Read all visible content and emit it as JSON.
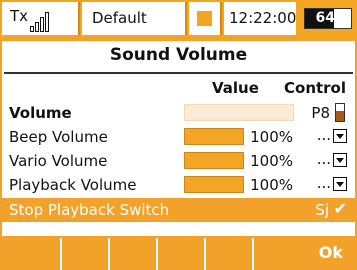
{
  "status": {
    "tx_label": "Tx",
    "profile": "Default",
    "time": "12:22:00",
    "battery_percent": 64,
    "battery_text": "64%"
  },
  "screen": {
    "title": "Sound Volume",
    "col_value": "Value",
    "col_control": "Control",
    "rows": [
      {
        "label": "Volume",
        "value_fraction": 1.0,
        "control": "P8"
      },
      {
        "label": "Beep Volume",
        "value_fraction": 1.0,
        "percent": "100%",
        "control": "..."
      },
      {
        "label": "Vario Volume",
        "value_fraction": 1.0,
        "percent": "100%",
        "control": "..."
      },
      {
        "label": "Playback Volume",
        "value_fraction": 1.0,
        "percent": "100%",
        "control": "..."
      },
      {
        "label": "Stop Playback Switch",
        "control": "Sj"
      }
    ]
  },
  "footer": {
    "ok_label": "Ok"
  },
  "colors": {
    "accent": "#f2a22a",
    "volume_bar": "#fdebd8",
    "bar_fill": "#f4a523"
  }
}
